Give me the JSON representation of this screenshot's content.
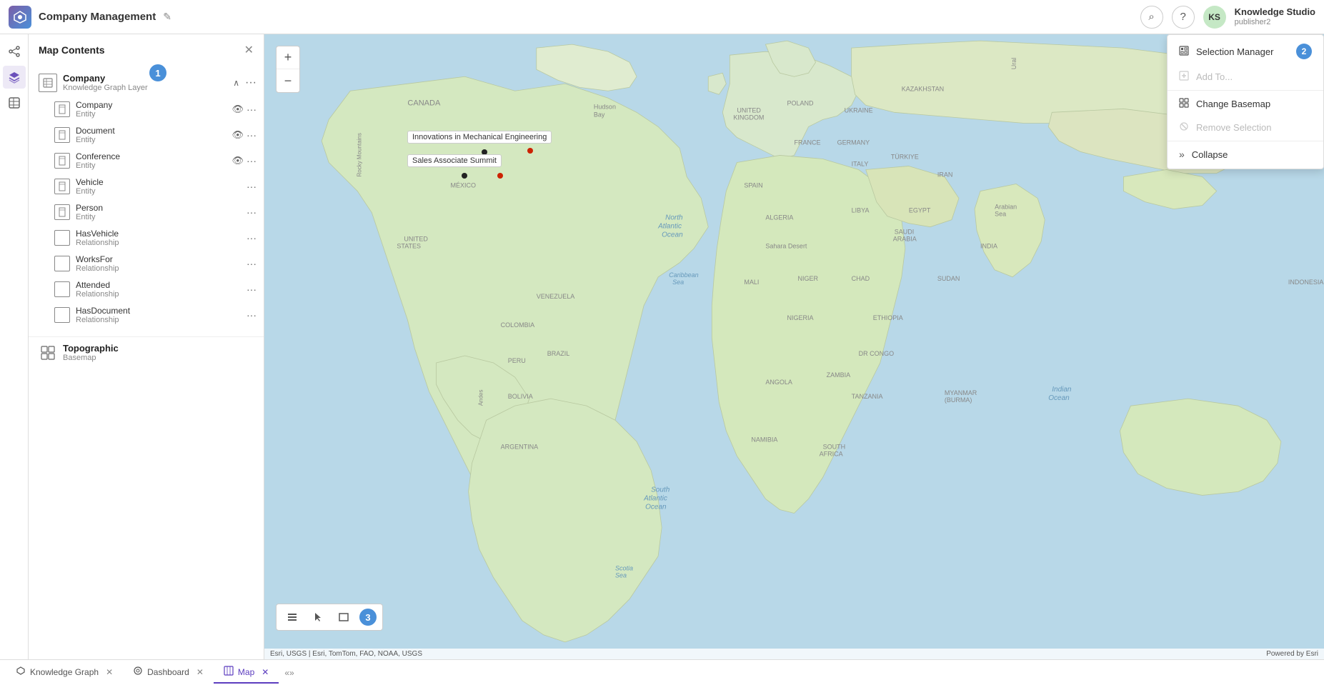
{
  "header": {
    "logo_text": "KS",
    "title": "Company Management",
    "edit_icon": "✎",
    "search_icon": "⌕",
    "help_icon": "?",
    "avatar_initials": "KS",
    "user_name": "Knowledge Studio",
    "user_role": "publisher2"
  },
  "map_contents": {
    "title": "Map Contents",
    "close_icon": "✕",
    "layer_group": {
      "name": "Company",
      "sub": "Knowledge Graph Layer"
    },
    "layers": [
      {
        "name": "Company",
        "sub": "Entity",
        "has_eye": true
      },
      {
        "name": "Document",
        "sub": "Entity",
        "has_eye": true
      },
      {
        "name": "Conference",
        "sub": "Entity",
        "has_eye": true
      },
      {
        "name": "Vehicle",
        "sub": "Entity",
        "has_eye": false
      },
      {
        "name": "Person",
        "sub": "Entity",
        "has_eye": false
      },
      {
        "name": "HasVehicle",
        "sub": "Relationship",
        "has_eye": false
      },
      {
        "name": "WorksFor",
        "sub": "Relationship",
        "has_eye": false
      },
      {
        "name": "Attended",
        "sub": "Relationship",
        "has_eye": false
      },
      {
        "name": "HasDocument",
        "sub": "Relationship",
        "has_eye": false
      }
    ],
    "basemap": {
      "name": "Topographic",
      "sub": "Basemap"
    }
  },
  "selection_panel": {
    "items": [
      {
        "icon": "☐",
        "label": "Selection Manager",
        "disabled": false
      },
      {
        "icon": "⊞",
        "label": "Add To...",
        "disabled": true
      },
      {
        "icon": "⊟",
        "label": "Change Basemap",
        "disabled": false
      },
      {
        "icon": "⊠",
        "label": "Remove Selection",
        "disabled": true
      },
      {
        "icon": "»",
        "label": "Collapse",
        "disabled": false
      }
    ]
  },
  "map": {
    "label1": "Innovations in Mechanical Engineering",
    "label2": "Sales Associate Summit",
    "attribution": "Esri, USGS | Esri, TomTom, FAO, NOAA, USGS",
    "attribution_right": "Powered by Esri"
  },
  "bottom_tabs": [
    {
      "icon": "⬡",
      "label": "Knowledge Graph",
      "active": false,
      "closable": true
    },
    {
      "icon": "◫",
      "label": "Dashboard",
      "active": false,
      "closable": true
    },
    {
      "icon": "⊞",
      "label": "Map",
      "active": true,
      "closable": true
    }
  ],
  "badges": {
    "badge1": "1",
    "badge2": "2",
    "badge3": "3"
  },
  "zoom": {
    "plus": "+",
    "minus": "−"
  }
}
